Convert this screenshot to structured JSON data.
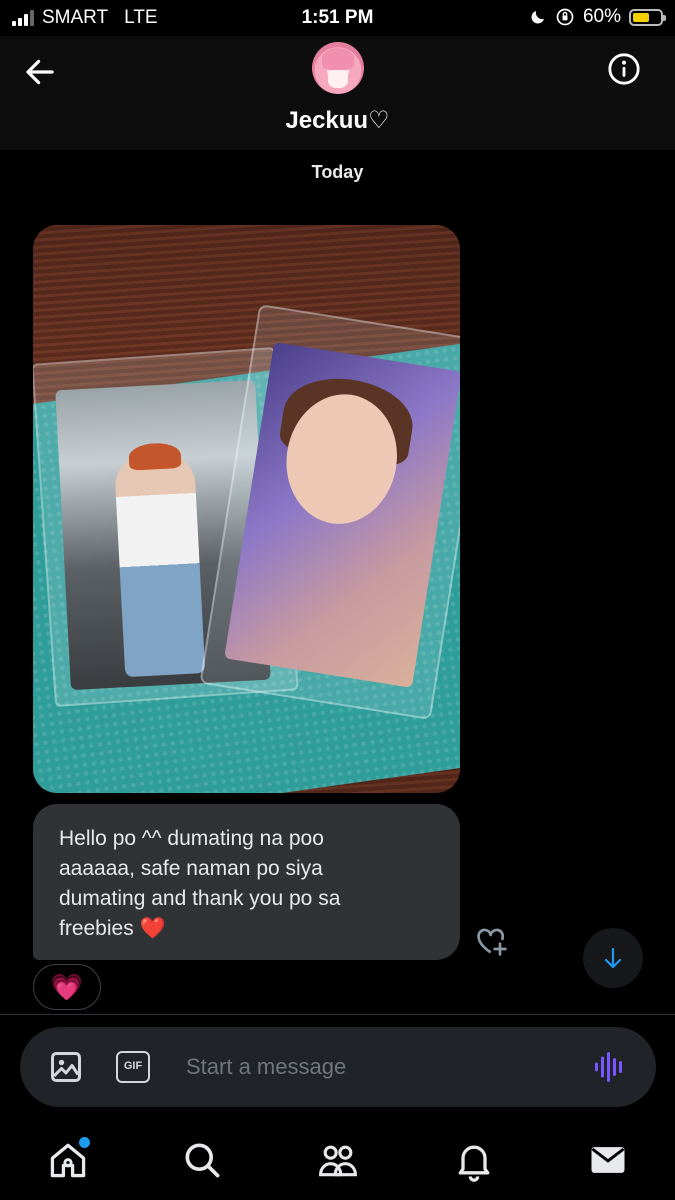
{
  "status_bar": {
    "carrier": "SMART",
    "network": "LTE",
    "time": "1:51 PM",
    "battery_percent": "60%",
    "battery_level": 0.6
  },
  "header": {
    "contact_name": "Jeckuu♡",
    "back_icon": "arrow-left-icon",
    "info_icon": "info-circle-icon"
  },
  "conversation": {
    "date_label": "Today",
    "message_text": "Hello po ^^ dumating na poo\naaaaaa, safe naman po siya\ndumating and thank you po sa\nfreebies ❤️",
    "reaction": "💗"
  },
  "composer": {
    "placeholder": "Start a message",
    "gif_label": "GIF"
  },
  "bottom_nav": {
    "items": [
      "home-icon",
      "search-icon",
      "communities-icon",
      "notifications-icon",
      "messages-icon"
    ]
  },
  "colors": {
    "accent": "#1d9bf0",
    "voice": "#7856ff",
    "bubble": "#2f3336"
  }
}
